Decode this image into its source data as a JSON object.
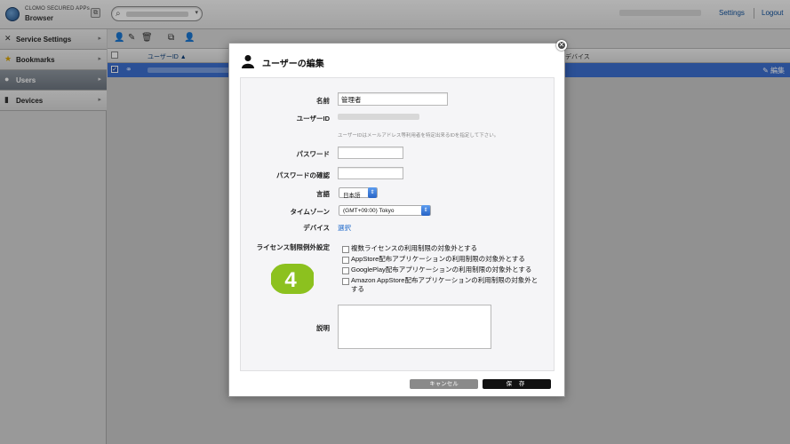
{
  "app": {
    "name": "CLOMO SECURED APPs",
    "sub": "Browser"
  },
  "topbar": {
    "settings": "Settings",
    "logout": "Logout"
  },
  "sidebar": {
    "items": [
      {
        "label": "Service Settings",
        "icon": "wrench-icon"
      },
      {
        "label": "Bookmarks",
        "icon": "star-icon"
      },
      {
        "label": "Users",
        "icon": "user-icon"
      },
      {
        "label": "Devices",
        "icon": "device-icon"
      }
    ]
  },
  "table": {
    "col_userid": "ユーザーID ▲",
    "col_device": "デバイス",
    "edit": "編集"
  },
  "modal": {
    "title": "ユーザーの編集",
    "fields": {
      "name_label": "名前",
      "name_value": "管理者",
      "userid_label": "ユーザーID",
      "userid_hint": "ユーザーIDはメールアドレス等利用者を特定出来るIDを指定して下さい。",
      "password_label": "パスワード",
      "password_confirm_label": "パスワードの確認",
      "language_label": "言語",
      "language_value": "日本語",
      "timezone_label": "タイムゾーン",
      "timezone_value": "(GMT+09:00) Tokyo",
      "device_label": "デバイス",
      "device_link": "選択",
      "license_label": "ライセンス制限例外設定",
      "license_options": [
        "複数ライセンスの利用制限の対象外とする",
        "AppStore配布アプリケーションの利用制限の対象外とする",
        "GooglePlay配布アプリケーションの利用制限の対象外とする",
        "Amazon AppStore配布アプリケーションの利用制限の対象外とする"
      ],
      "description_label": "説明"
    },
    "badge": "4",
    "cancel": "キャンセル",
    "save": "保 存"
  },
  "colors": {
    "accent": "#3c6fd0",
    "badge": "#8cc11f"
  }
}
